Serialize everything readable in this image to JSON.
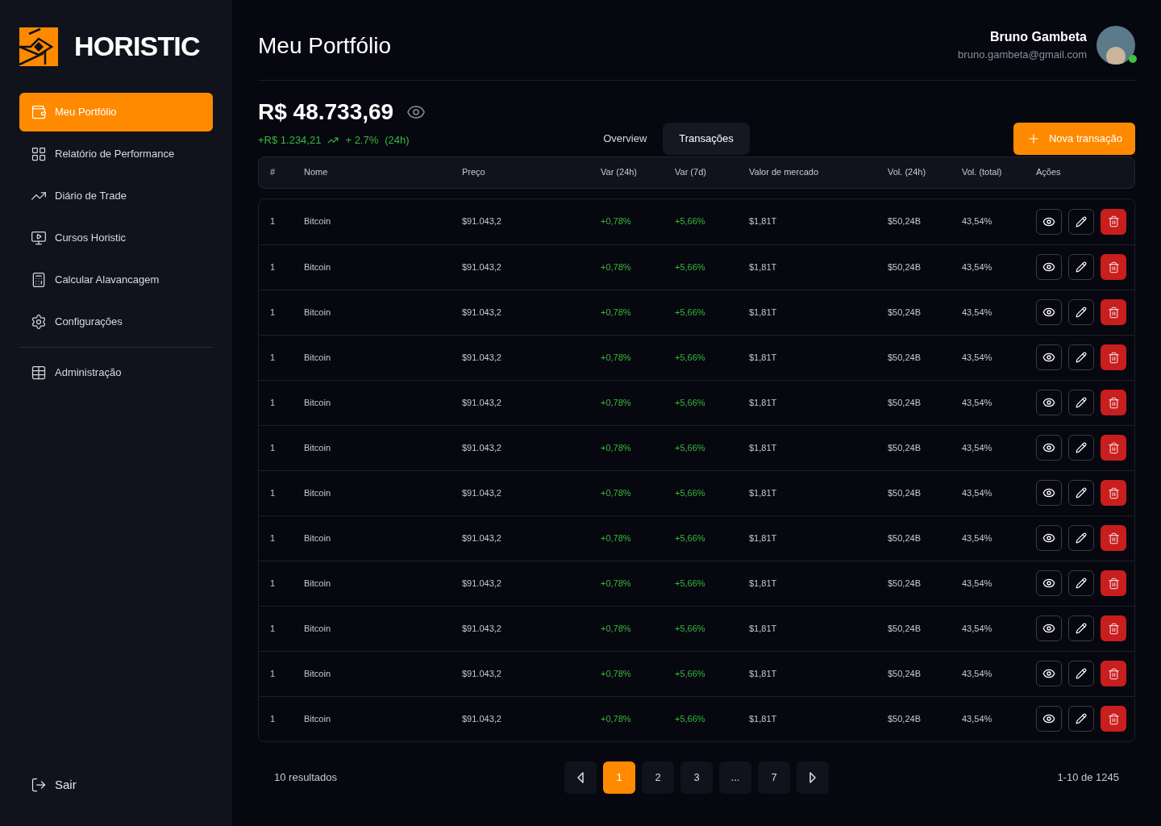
{
  "brand": {
    "name": "HORISTIC"
  },
  "sidebar": {
    "items": [
      {
        "label": "Meu Portfólio",
        "selected": true
      },
      {
        "label": "Relatório de Performance",
        "selected": false
      },
      {
        "label": "Diário de Trade",
        "selected": false
      },
      {
        "label": "Cursos Horistic",
        "selected": false
      },
      {
        "label": "Calcular Alavancagem",
        "selected": false
      },
      {
        "label": "Configurações",
        "selected": false
      }
    ],
    "admin_items": [
      {
        "label": "Administração",
        "selected": false
      }
    ],
    "logout": "Sair"
  },
  "header": {
    "title": "Meu Portfólio",
    "user": {
      "name": "Bruno Gambeta",
      "email": "bruno.gambeta@gmail.com",
      "online": true
    }
  },
  "balance": {
    "amount": "R$ 48.733,69",
    "change": "+R$ 1.234,21",
    "percent": "+ 2.7%",
    "period": "(24h)"
  },
  "tabs": [
    {
      "label": "Overview",
      "selected": false
    },
    {
      "label": "Transações",
      "selected": true
    }
  ],
  "new_button": "Nova transação",
  "table": {
    "columns": [
      "#",
      "Nome",
      "Preço",
      "Var (24h)",
      "Var (7d)",
      "Valor de mercado",
      "Vol. (24h)",
      "Vol. (total)",
      "Ações"
    ],
    "rows": [
      [
        "1",
        "Bitcoin",
        "$91.043,2",
        "+0,78%",
        "+5,66%",
        "$1,81T",
        "$50,24B",
        "43,54%"
      ],
      [
        "1",
        "Bitcoin",
        "$91.043,2",
        "+0,78%",
        "+5,66%",
        "$1,81T",
        "$50,24B",
        "43,54%"
      ],
      [
        "1",
        "Bitcoin",
        "$91.043,2",
        "+0,78%",
        "+5,66%",
        "$1,81T",
        "$50,24B",
        "43,54%"
      ],
      [
        "1",
        "Bitcoin",
        "$91.043,2",
        "+0,78%",
        "+5,66%",
        "$1,81T",
        "$50,24B",
        "43,54%"
      ],
      [
        "1",
        "Bitcoin",
        "$91.043,2",
        "+0,78%",
        "+5,66%",
        "$1,81T",
        "$50,24B",
        "43,54%"
      ],
      [
        "1",
        "Bitcoin",
        "$91.043,2",
        "+0,78%",
        "+5,66%",
        "$1,81T",
        "$50,24B",
        "43,54%"
      ],
      [
        "1",
        "Bitcoin",
        "$91.043,2",
        "+0,78%",
        "+5,66%",
        "$1,81T",
        "$50,24B",
        "43,54%"
      ],
      [
        "1",
        "Bitcoin",
        "$91.043,2",
        "+0,78%",
        "+5,66%",
        "$1,81T",
        "$50,24B",
        "43,54%"
      ],
      [
        "1",
        "Bitcoin",
        "$91.043,2",
        "+0,78%",
        "+5,66%",
        "$1,81T",
        "$50,24B",
        "43,54%"
      ],
      [
        "1",
        "Bitcoin",
        "$91.043,2",
        "+0,78%",
        "+5,66%",
        "$1,81T",
        "$50,24B",
        "43,54%"
      ],
      [
        "1",
        "Bitcoin",
        "$91.043,2",
        "+0,78%",
        "+5,66%",
        "$1,81T",
        "$50,24B",
        "43,54%"
      ],
      [
        "1",
        "Bitcoin",
        "$91.043,2",
        "+0,78%",
        "+5,66%",
        "$1,81T",
        "$50,24B",
        "43,54%"
      ]
    ]
  },
  "footer": {
    "results": "10 resultados",
    "pages": [
      {
        "label": "1",
        "selected": true
      },
      {
        "label": "2",
        "selected": false
      },
      {
        "label": "3",
        "selected": false
      },
      {
        "label": "...",
        "selected": false
      },
      {
        "label": "7",
        "selected": false
      }
    ],
    "range": "1-10 de 1245"
  }
}
